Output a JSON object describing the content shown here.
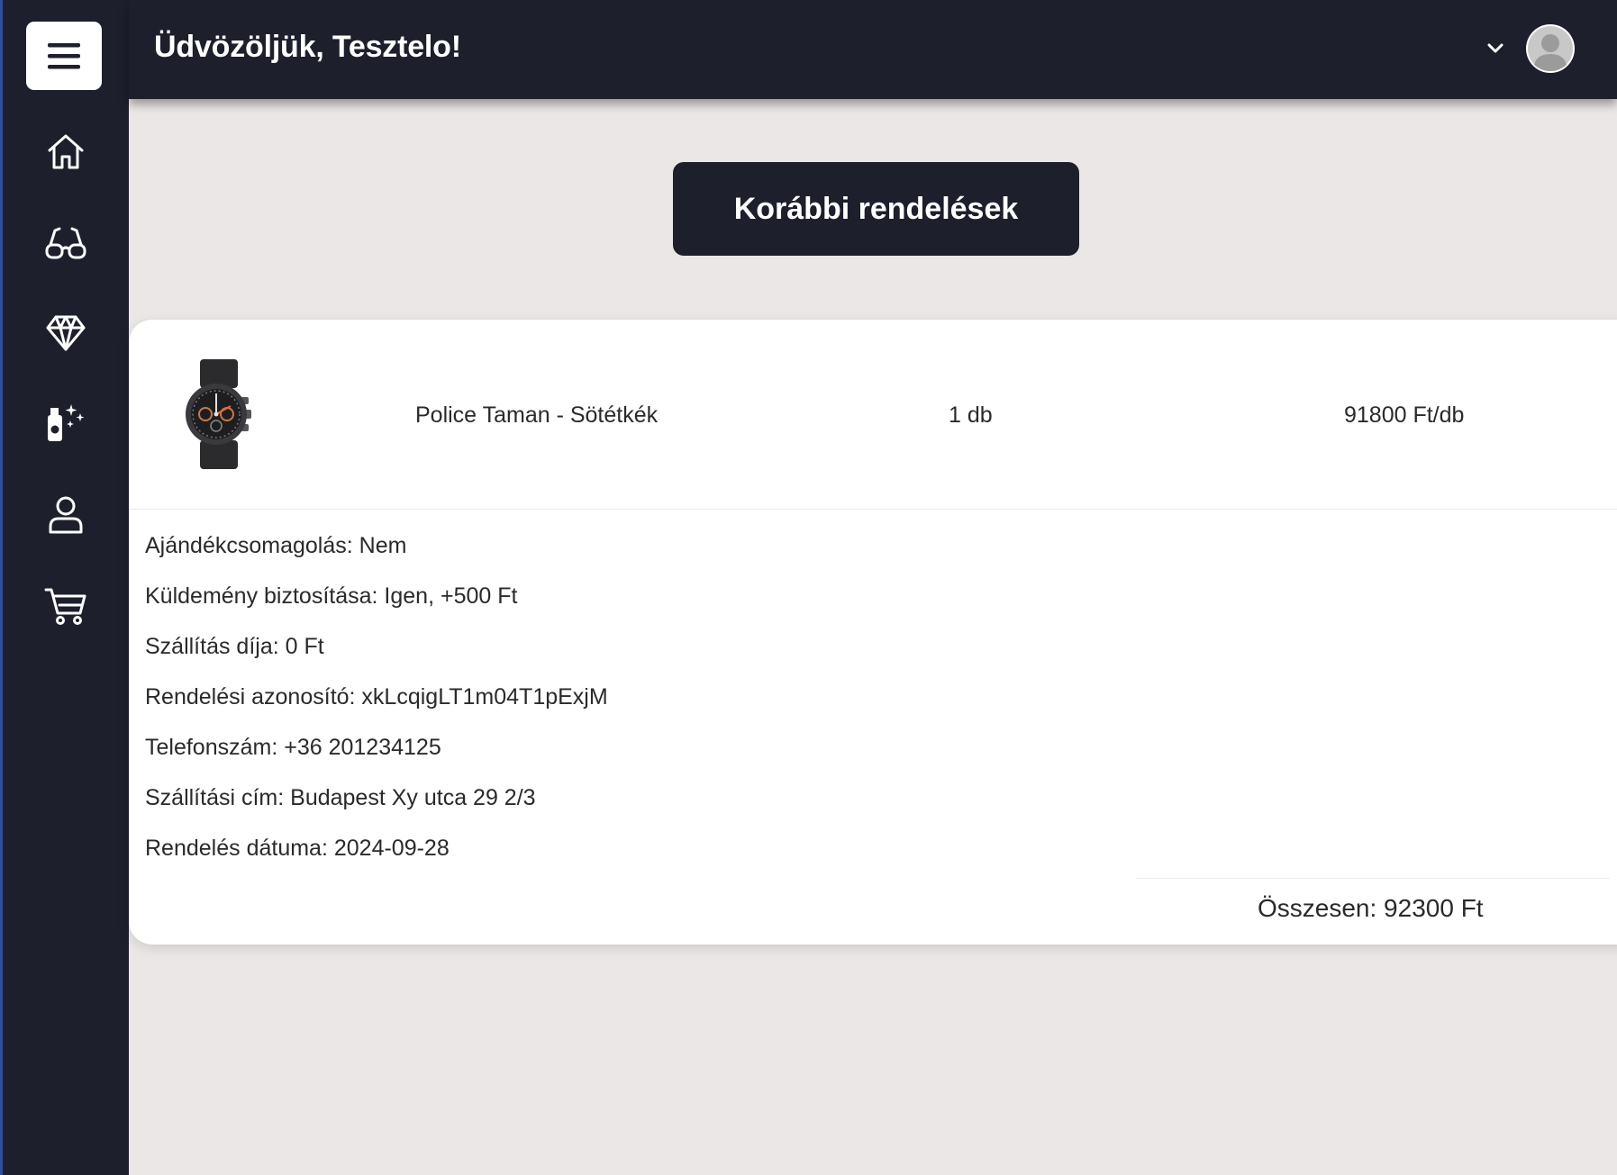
{
  "header": {
    "welcome_text": "Üdvözöljük, Tesztelo!"
  },
  "sidebar": {
    "items": [
      {
        "icon": "home-icon"
      },
      {
        "icon": "glasses-icon"
      },
      {
        "icon": "diamond-icon"
      },
      {
        "icon": "perfume-icon"
      },
      {
        "icon": "user-icon"
      },
      {
        "icon": "cart-icon"
      }
    ]
  },
  "page": {
    "title": "Korábbi rendelések"
  },
  "order": {
    "item": {
      "name": "Police Taman - Sötétkék",
      "quantity": "1 db",
      "price": "91800 Ft/db"
    },
    "details": [
      "Ajándékcsomagolás: Nem",
      "Küldemény biztosítása: Igen, +500 Ft",
      "Szállítás díja: 0 Ft",
      "Rendelési azonosító: xkLcqigLT1m04T1pExjM",
      "Telefonszám: +36 201234125",
      "Szállítási cím: Budapest Xy utca 29 2/3",
      "Rendelés dátuma: 2024-09-28"
    ],
    "total": "Összesen: 92300 Ft"
  },
  "colors": {
    "dark": "#1d1f2c",
    "background": "#ebe7e6",
    "card": "#ffffff"
  }
}
